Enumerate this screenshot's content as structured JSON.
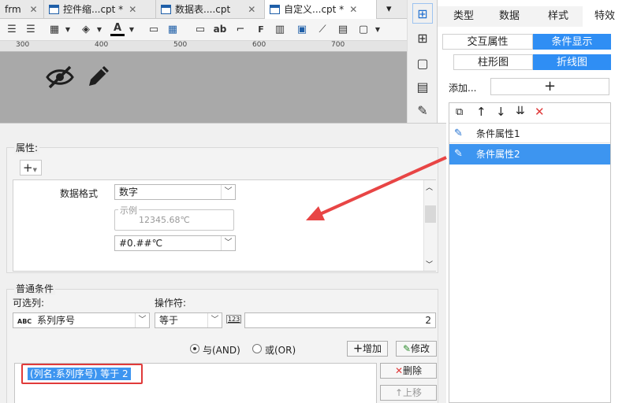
{
  "tabs": [
    {
      "label": "frm"
    },
    {
      "label": "控件缩...cpt *"
    },
    {
      "label": "数据表....cpt"
    },
    {
      "label": "自定义...cpt *"
    }
  ],
  "ruler": {
    "t300": "300",
    "t400": "400",
    "t500": "500",
    "t600": "600",
    "t700": "700"
  },
  "right_panel": {
    "tabs": [
      "类型",
      "数据",
      "样式",
      "特效"
    ],
    "sub1": {
      "left": "交互属性",
      "right": "条件显示"
    },
    "sub2": {
      "left": "柱形图",
      "right": "折线图"
    },
    "add_label": "添加...",
    "add_symbol": "+",
    "items": [
      {
        "label": "条件属性1",
        "selected": false
      },
      {
        "label": "条件属性2",
        "selected": true
      }
    ]
  },
  "dialog": {
    "props_title": "属性:",
    "add_symbol": "+",
    "format_label": "数据格式",
    "format_value": "数字",
    "example_label": "示例",
    "example_value": "12345.68℃",
    "pattern_value": "#0.##℃",
    "common_title": "普通条件",
    "col_label": "可选列:",
    "col_value": "系列序号",
    "col_icon_text": "ABC",
    "op_label": "操作符:",
    "op_value": "等于",
    "val_icon_text": "123",
    "val_value": "2",
    "and_label": "与(AND)",
    "or_label": "或(OR)",
    "add_btn": "增加",
    "modify_btn": "修改",
    "delete_btn": "删除",
    "up_btn": "上移",
    "condition_text": "(列名:系列序号) 等于 2"
  },
  "colors": {
    "accent": "#2f8ef4",
    "arrow": "#e84545",
    "highlight": "#dd3333"
  }
}
